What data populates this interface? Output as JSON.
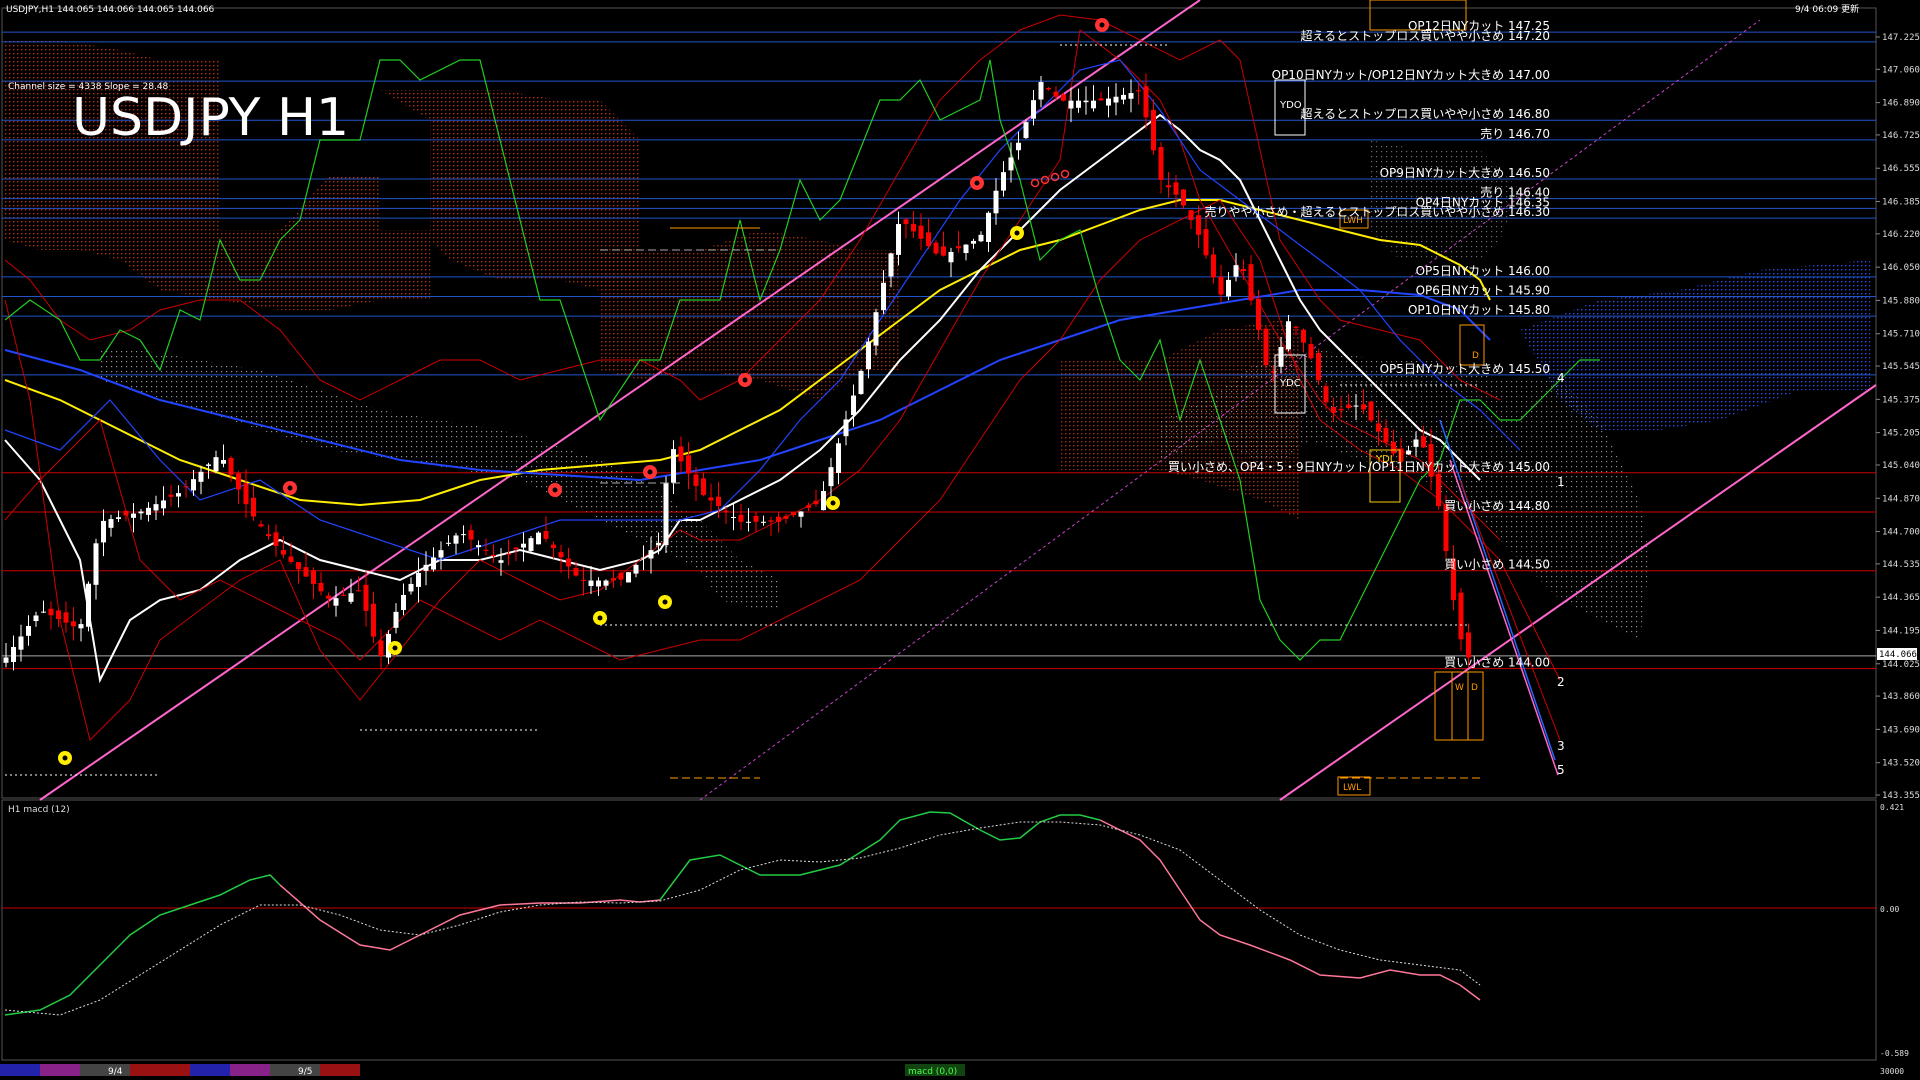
{
  "header": {
    "quote": "USDJPY,H1  144.065 144.066 144.065 144.066",
    "timestamp": "9/4 06:09 更新",
    "channel_info": "Channel size = 4338 Slope = 28.48",
    "big_title": "USDJPY H1"
  },
  "colors": {
    "background": "#000000",
    "grid_h": "#2255cc",
    "grid_red": "#cc0000",
    "bull": "#ffffff",
    "bear": "#ff0000",
    "channel": "#ff66cc",
    "ma_white": "#ffffff",
    "ma_yellow": "#ffee00",
    "ma_blue": "#2244ff",
    "chikou": "#22cc22",
    "kumo_red": "#cc3311",
    "kumo_blue": "#3355ff",
    "label_box": "#ff9900"
  },
  "price_axis": [
    "147.225",
    "147.060",
    "146.890",
    "146.725",
    "146.555",
    "146.385",
    "146.220",
    "146.050",
    "145.880",
    "145.710",
    "145.545",
    "145.375",
    "145.205",
    "145.040",
    "144.870",
    "144.700",
    "144.535",
    "144.365",
    "144.195",
    "144.025",
    "143.860",
    "143.690",
    "143.520",
    "143.355"
  ],
  "current_price": "144.066",
  "level_labels": [
    {
      "text": "OP12日NYカット 147.25"
    },
    {
      "text": "超えるとストップロス買いやや小さめ 147.20"
    },
    {
      "text": "OP10日NYカット/OP12日NYカット大きめ 147.00"
    },
    {
      "text": "超えるとストップロス買いやや小さめ 146.80"
    },
    {
      "text": "売り 146.70"
    },
    {
      "text": "OP9日NYカット大きめ 146.50"
    },
    {
      "text": "売り 146.40"
    },
    {
      "text": "OP4日NYカット 146.35"
    },
    {
      "text": "売りやや小さめ・超えるとストップロス買いやや小さめ 146.30"
    },
    {
      "text": "OP5日NYカット 146.00"
    },
    {
      "text": "OP6日NYカット 145.90"
    },
    {
      "text": "OP10日NYカット 145.80"
    },
    {
      "text": "OP5日NYカット大きめ 145.50"
    },
    {
      "text": "買い小さめ、OP4・5・9日NYカット/OP11日NYカット大きめ 145.00"
    },
    {
      "text": "買い小さめ 144.80"
    },
    {
      "text": "買い小さめ 144.50"
    },
    {
      "text": "買い小さめ 144.00"
    }
  ],
  "box_labels": {
    "ydo": "YDO",
    "ydc": "YDC",
    "ydl": "YDL",
    "lwh": "LWH",
    "lwl": "LWL",
    "w": "W",
    "d": "D"
  },
  "wave_labels": [
    "1",
    "2",
    "3",
    "4",
    "5"
  ],
  "macd": {
    "label": "H1  macd (12)",
    "axis": [
      "0.421",
      "0.00",
      "-0.589"
    ],
    "bottom_value": "30000"
  },
  "bottom_bar": {
    "date1": "9/4",
    "date2": "9/5",
    "indicator_tab": "macd (0,0)"
  }
}
